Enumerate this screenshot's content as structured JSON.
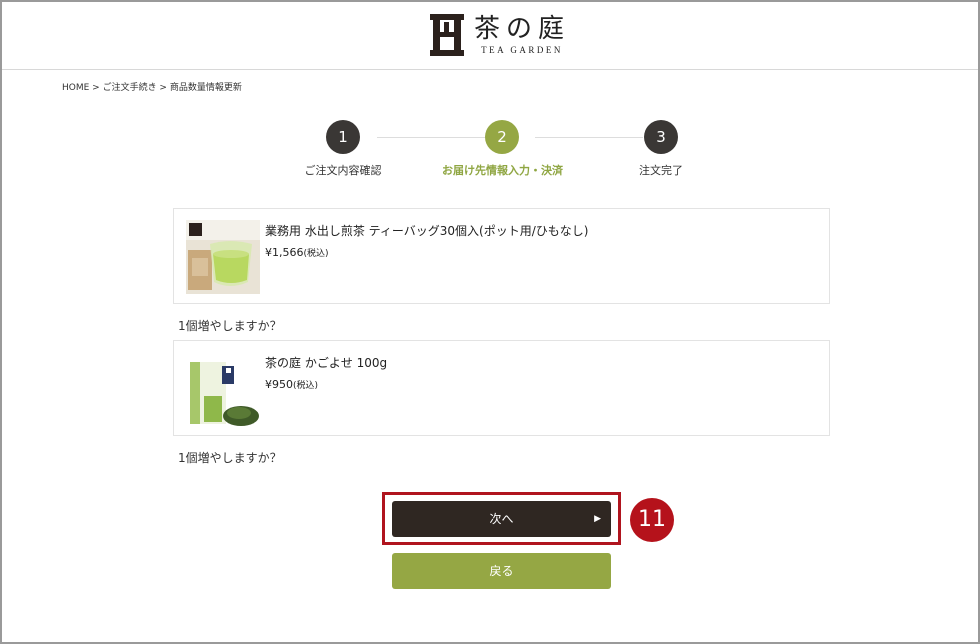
{
  "brand": {
    "kanji": "茶の庭",
    "sub": "TEA GARDEN"
  },
  "breadcrumb": "HOME > ご注文手続き > 商品数量情報更新",
  "steps": [
    {
      "number": "1",
      "label": "ご注文内容確認",
      "state": "done"
    },
    {
      "number": "2",
      "label": "お届け先情報入力・決済",
      "state": "active"
    },
    {
      "number": "3",
      "label": "注文完了",
      "state": "pending"
    }
  ],
  "products": [
    {
      "name": "業務用 水出し煎茶 ティーバッグ30個入(ポット用/ひもなし)",
      "price": "¥1,566",
      "tax": "(税込)",
      "prompt": "1個増やしますか？"
    },
    {
      "name": "茶の庭 かごよせ 100g",
      "price": "¥950",
      "tax": "(税込)",
      "prompt": "1個増やしますか？"
    }
  ],
  "buttons": {
    "next": "次へ",
    "back": "戻る"
  },
  "annotation": {
    "badge": "11"
  },
  "colors": {
    "accent_green": "#95a744",
    "dark": "#2f2722",
    "highlight_red": "#b0141e"
  }
}
